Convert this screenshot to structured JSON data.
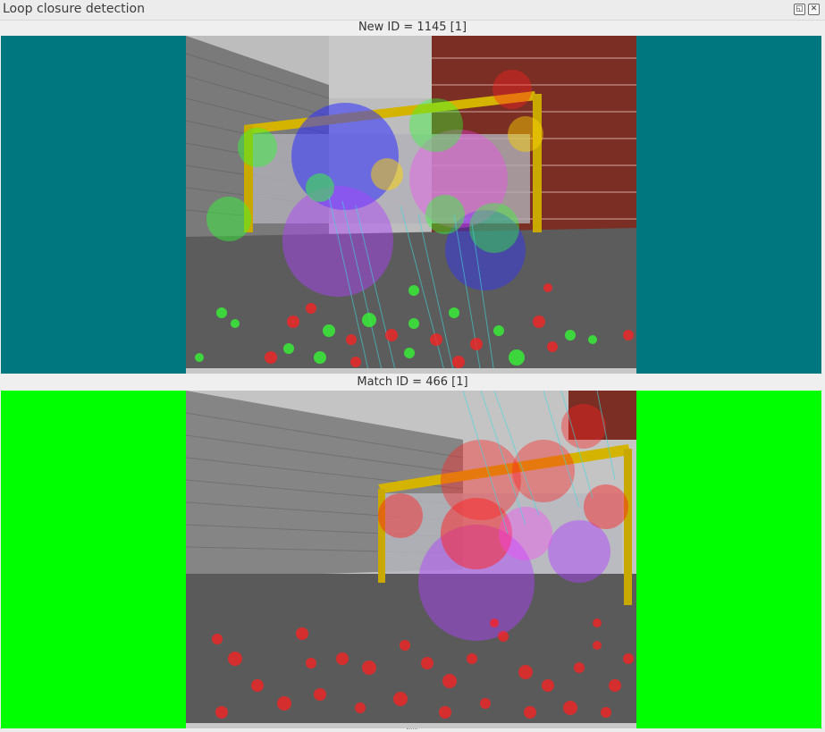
{
  "window": {
    "title": "Loop closure detection",
    "float_icon": "restore-icon",
    "close_icon": "close-icon"
  },
  "new_panel": {
    "label": "New ID = 1145 [1]",
    "background_color": "#00777f"
  },
  "match_panel": {
    "label": "Match ID = 466 [1]",
    "background_color": "#00ff00"
  },
  "colors": {
    "keypoint_green": "#33ff33",
    "keypoint_red": "#ff2020",
    "keypoint_blue": "#3030ff",
    "keypoint_purple": "#b040ff",
    "match_line": "#40d8e0",
    "goal_frame": "#d4b400"
  }
}
